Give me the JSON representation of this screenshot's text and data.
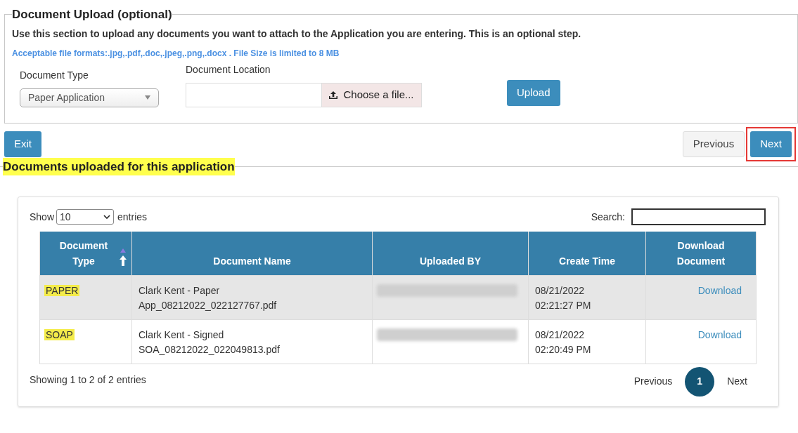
{
  "upload_section": {
    "legend": "Document Upload (optional)",
    "instructions": "Use this section to upload any documents you want to attach to the Application you are entering. This is an optional step.",
    "formats_note": "Acceptable file formats:.jpg,.pdf,.doc,.jpeg,.png,.docx . File Size is limited to 8 MB",
    "document_type": {
      "label": "Document Type",
      "value": "Paper Application"
    },
    "document_location": {
      "label": "Document Location",
      "button": "Choose a file..."
    },
    "upload_button": "Upload"
  },
  "nav_buttons": [
    {
      "label": "Exit",
      "kind": "primary",
      "highlighted": false
    },
    {
      "label": "Previous",
      "kind": "secondary",
      "highlighted": false
    },
    {
      "label": "Next",
      "kind": "primary",
      "highlighted": true
    }
  ],
  "documents_section": {
    "legend": "Documents uploaded for this application",
    "legend_highlighted": true,
    "show_label": "Show",
    "page_size": "10",
    "entries_label": "entries",
    "search_label": "Search:",
    "table": {
      "columns": [
        {
          "label": "Document Type",
          "sorted": true
        },
        {
          "label": "Document Name",
          "sorted": false
        },
        {
          "label": "Uploaded BY",
          "sorted": false
        },
        {
          "label": "Create Time",
          "sorted": false
        },
        {
          "label": "Download Document",
          "sorted": false
        }
      ],
      "rows": [
        {
          "type": "PAPER",
          "type_highlighted": true,
          "name": "Clark Kent - Paper App_08212022_022127767.pdf",
          "uploaded_by_redacted": true,
          "create_time": "08/21/2022 02:21:27 PM",
          "download": "Download"
        },
        {
          "type": "SOAP",
          "type_highlighted": true,
          "name": "Clark Kent - Signed SOA_08212022_022049813.pdf",
          "uploaded_by_redacted": true,
          "create_time": "08/21/2022 02:20:49 PM",
          "download": "Download"
        }
      ]
    },
    "info": "Showing 1 to 2 of 2 entries",
    "pagination": {
      "previous": "Previous",
      "pages": [
        {
          "label": "1",
          "selected": true
        }
      ],
      "next": "Next"
    }
  }
}
